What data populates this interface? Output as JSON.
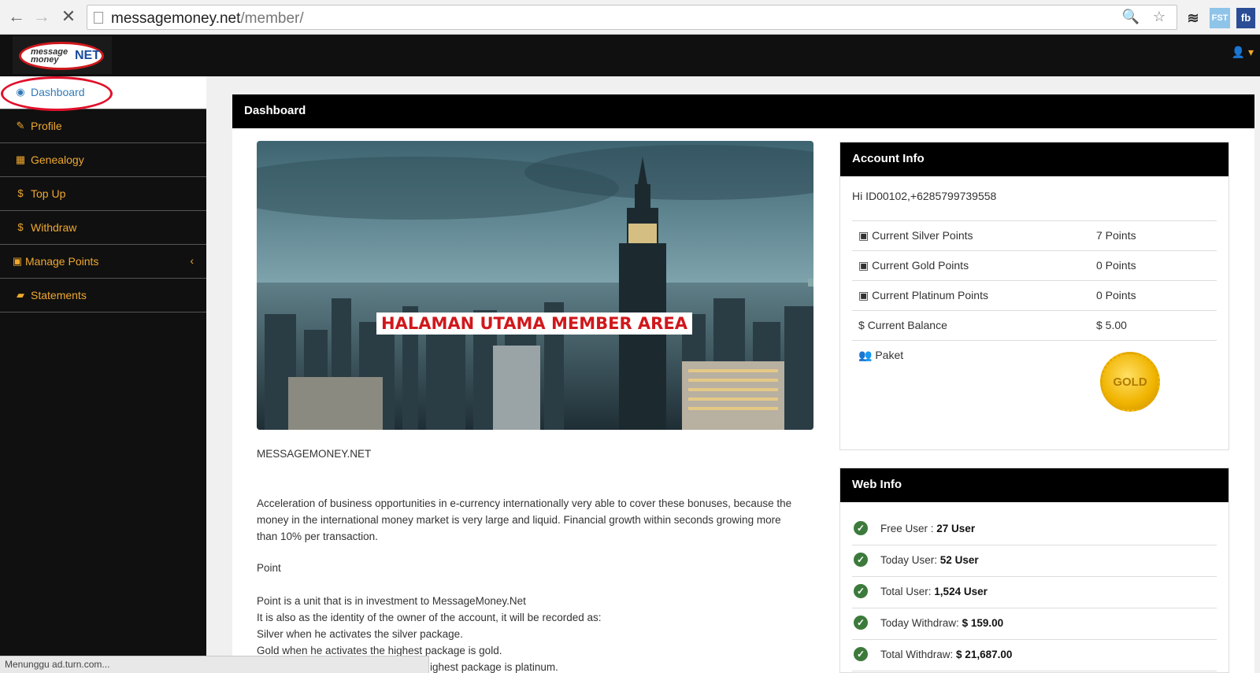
{
  "browser": {
    "url_domain": "messagemoney.net",
    "url_path": "/member/",
    "ext_fst": "FST",
    "ext_fb": "fb"
  },
  "logo": {
    "line1": "message",
    "line2": "money",
    "net": "NET"
  },
  "sidebar": {
    "items": [
      {
        "label": "Dashboard",
        "icon": "dashboard-icon",
        "glyph": "◉"
      },
      {
        "label": "Profile",
        "icon": "wrench-icon",
        "glyph": "✎"
      },
      {
        "label": "Genealogy",
        "icon": "table-icon",
        "glyph": "▦"
      },
      {
        "label": "Top Up",
        "icon": "dollar-icon",
        "glyph": "$"
      },
      {
        "label": "Withdraw",
        "icon": "dollar-icon",
        "glyph": "$"
      },
      {
        "label": "Manage Points",
        "icon": "gift-icon",
        "glyph": "▣"
      },
      {
        "label": "Statements",
        "icon": "book-icon",
        "glyph": "▰"
      }
    ]
  },
  "main": {
    "panel_title": "Dashboard",
    "hero_banner": "HALAMAN UTAMA MEMBER AREA",
    "site_name": "MESSAGEMONEY.NET",
    "paragraph1": "Acceleration of business opportunities in e-currency internationally very able to cover these bonuses, because the money in the international money market is very large and liquid. Financial growth within seconds growing more than 10% per transaction.",
    "point_heading": "Point",
    "point_lines": [
      "Point is a unit that is in investment to MessageMoney.Net",
      "It is also as the identity of the owner of the account, it will be recorded as:",
      "Silver when he activates the silver package.",
      "Gold when he activates the highest package is gold.",
      "ighest package is platinum."
    ]
  },
  "account_info": {
    "title": "Account Info",
    "greeting": "Hi ID00102,+6285799739558",
    "rows": [
      {
        "label": "Current Silver Points",
        "value": "7 Points"
      },
      {
        "label": "Current Gold Points",
        "value": "0 Points"
      },
      {
        "label": "Current Platinum Points",
        "value": "0 Points"
      },
      {
        "label": "Current Balance",
        "value": "$ 5.00"
      },
      {
        "label": "Paket",
        "value": ""
      }
    ],
    "badge": "GOLD"
  },
  "web_info": {
    "title": "Web Info",
    "rows": [
      {
        "label": "Free User :",
        "value": "27 User"
      },
      {
        "label": "Today User:",
        "value": "52 User"
      },
      {
        "label": "Total User:",
        "value": "1,524 User"
      },
      {
        "label": "Today Withdraw:",
        "value": "$ 159.00"
      },
      {
        "label": "Total Withdraw:",
        "value": "$ 21,687.00"
      }
    ]
  },
  "status_text": "Menunggu ad.turn.com..."
}
